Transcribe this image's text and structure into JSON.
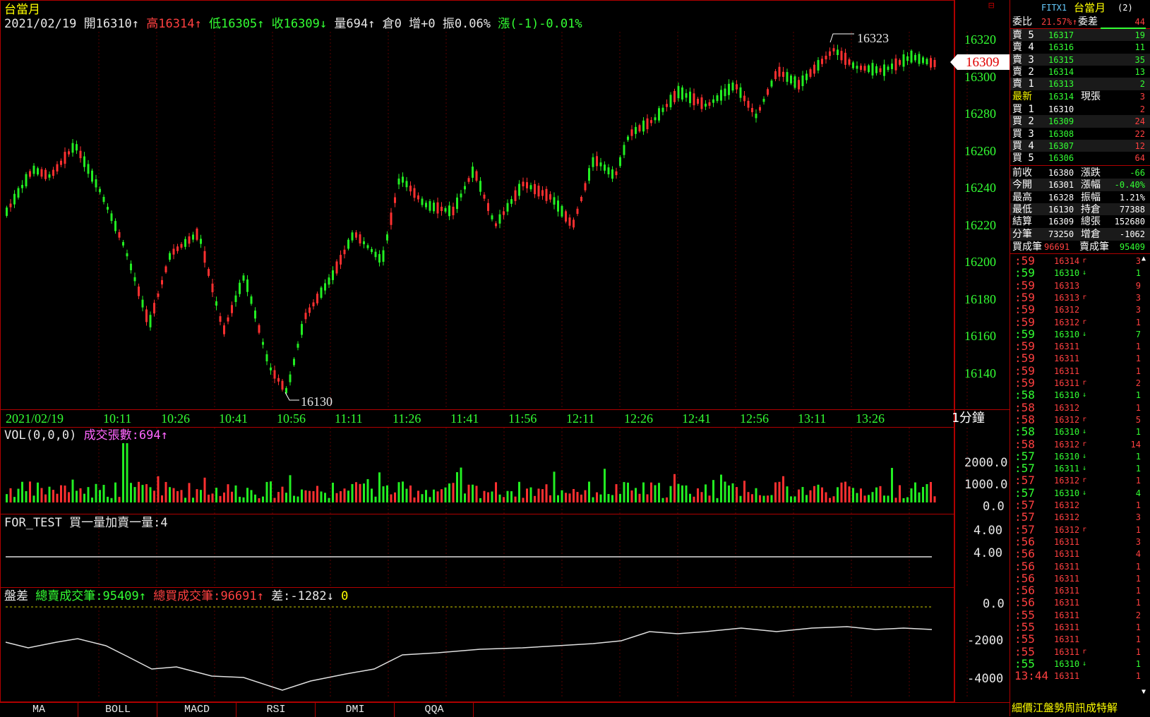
{
  "header": {
    "title": "台當月",
    "date": "2021/02/19",
    "open_label": "開",
    "open": "16310",
    "open_arrow": "↑",
    "high_label": "高",
    "high": "16314",
    "high_arrow": "↑",
    "low_label": "低",
    "low": "16305",
    "low_arrow": "↑",
    "close_label": "收",
    "close": "16309",
    "close_arrow": "↓",
    "vol_label": "量",
    "vol": "694",
    "vol_arrow": "↑",
    "oi_label": "倉",
    "oi": "0",
    "inc_label": "增",
    "inc": "+0",
    "amp_label": "振",
    "amp": "0.06%",
    "chg_label": "漲",
    "chg": "(-1)-0.01%"
  },
  "price_panel": {
    "y_ticks": [
      "16320",
      "16300",
      "16280",
      "16260",
      "16240",
      "16220",
      "16200",
      "16180",
      "16160",
      "16140"
    ],
    "current_price": "16309",
    "max_label": "16323",
    "min_label": "16130",
    "close_button": "⊟"
  },
  "time_axis": {
    "labels": [
      "2021/02/19",
      "10:11",
      "10:26",
      "10:41",
      "10:56",
      "11:11",
      "11:26",
      "11:41",
      "11:56",
      "12:11",
      "12:26",
      "12:41",
      "12:56",
      "13:11",
      "13:26"
    ],
    "period": "1分鐘"
  },
  "volume_panel": {
    "title": "VOL(0,0,0)",
    "label": "成交張數:",
    "value": "694",
    "arrow": "↑",
    "y_ticks": [
      "2000.0",
      "1000.0",
      "0.0"
    ]
  },
  "for_test_panel": {
    "title": "FOR_TEST",
    "label": "買一量加賣一量:",
    "value": "4",
    "y_ticks": [
      "4.00",
      "4.00"
    ]
  },
  "spread_panel": {
    "title": "盤差",
    "sell_label": "總賣成交筆:",
    "sell_value": "95409",
    "sell_arrow": "↑",
    "buy_label": "總買成交筆:",
    "buy_value": "96691",
    "buy_arrow": "↑",
    "diff_label": "差:",
    "diff_value": "-1282",
    "diff_arrow": "↓",
    "extra_value": "0",
    "y_ticks": [
      "0.0",
      "-2000",
      "-4000"
    ]
  },
  "quote": {
    "code": "FITX1",
    "name": "台當月",
    "badge": "(2)",
    "ratio_label": "委比",
    "ratio": "21.57%",
    "ratio_arrow": "↑",
    "diff_label": "委差",
    "diff": "44",
    "asks": [
      {
        "label": "賣 5",
        "price": "16317",
        "qty": "19"
      },
      {
        "label": "賣 4",
        "price": "16316",
        "qty": "11"
      },
      {
        "label": "賣 3",
        "price": "16315",
        "qty": "35"
      },
      {
        "label": "賣 2",
        "price": "16314",
        "qty": "13"
      },
      {
        "label": "賣 1",
        "price": "16313",
        "qty": "2"
      }
    ],
    "last": {
      "label": "最新",
      "price": "16314",
      "qty_label": "現張",
      "qty": "3"
    },
    "bids": [
      {
        "label": "買 1",
        "price": "16310",
        "qty": "2"
      },
      {
        "label": "買 2",
        "price": "16309",
        "qty": "24"
      },
      {
        "label": "買 3",
        "price": "16308",
        "qty": "22"
      },
      {
        "label": "買 4",
        "price": "16307",
        "qty": "12"
      },
      {
        "label": "買 5",
        "price": "16306",
        "qty": "64"
      }
    ],
    "stats": [
      {
        "l1": "前收",
        "v1": "16380",
        "l2": "漲跌",
        "v2": "-66"
      },
      {
        "l1": "今開",
        "v1": "16301",
        "l2": "漲幅",
        "v2": "-0.40%"
      },
      {
        "l1": "最高",
        "v1": "16328",
        "l2": "振幅",
        "v2": "1.21%"
      },
      {
        "l1": "最低",
        "v1": "16130",
        "l2": "持倉",
        "v2": "77388"
      },
      {
        "l1": "結算",
        "v1": "16309",
        "l2": "總張",
        "v2": "152680"
      },
      {
        "l1": "分筆",
        "v1": "73250",
        "l2": "增倉",
        "v2": "-1062"
      }
    ],
    "trades_row": {
      "l1": "買成筆",
      "v1": "96691",
      "l2": "賣成筆",
      "v2": "95409"
    }
  },
  "ticks": [
    {
      "t": ":59",
      "p": "16314",
      "m": "r",
      "q": "3",
      "c": "red"
    },
    {
      "t": ":59",
      "p": "16310",
      "m": "↓",
      "q": "1",
      "c": "grn"
    },
    {
      "t": ":59",
      "p": "16313",
      "m": "",
      "q": "9",
      "c": "red"
    },
    {
      "t": ":59",
      "p": "16313",
      "m": "r",
      "q": "3",
      "c": "red"
    },
    {
      "t": ":59",
      "p": "16312",
      "m": "",
      "q": "3",
      "c": "red"
    },
    {
      "t": ":59",
      "p": "16312",
      "m": "r",
      "q": "1",
      "c": "red"
    },
    {
      "t": ":59",
      "p": "16310",
      "m": "↓",
      "q": "7",
      "c": "grn"
    },
    {
      "t": ":59",
      "p": "16311",
      "m": "",
      "q": "1",
      "c": "red"
    },
    {
      "t": ":59",
      "p": "16311",
      "m": "",
      "q": "1",
      "c": "red"
    },
    {
      "t": ":59",
      "p": "16311",
      "m": "",
      "q": "1",
      "c": "red"
    },
    {
      "t": ":59",
      "p": "16311",
      "m": "r",
      "q": "2",
      "c": "red"
    },
    {
      "t": ":58",
      "p": "16310",
      "m": "↓",
      "q": "1",
      "c": "grn"
    },
    {
      "t": ":58",
      "p": "16312",
      "m": "",
      "q": "1",
      "c": "red"
    },
    {
      "t": ":58",
      "p": "16312",
      "m": "r",
      "q": "5",
      "c": "red"
    },
    {
      "t": ":58",
      "p": "16310",
      "m": "↓",
      "q": "1",
      "c": "grn"
    },
    {
      "t": ":58",
      "p": "16312",
      "m": "r",
      "q": "14",
      "c": "red"
    },
    {
      "t": ":57",
      "p": "16310",
      "m": "↓",
      "q": "1",
      "c": "grn"
    },
    {
      "t": ":57",
      "p": "16311",
      "m": "↓",
      "q": "1",
      "c": "grn"
    },
    {
      "t": ":57",
      "p": "16312",
      "m": "r",
      "q": "1",
      "c": "red"
    },
    {
      "t": ":57",
      "p": "16310",
      "m": "↓",
      "q": "4",
      "c": "grn"
    },
    {
      "t": ":57",
      "p": "16312",
      "m": "",
      "q": "1",
      "c": "red"
    },
    {
      "t": ":57",
      "p": "16312",
      "m": "",
      "q": "3",
      "c": "red"
    },
    {
      "t": ":57",
      "p": "16312",
      "m": "r",
      "q": "1",
      "c": "red"
    },
    {
      "t": ":56",
      "p": "16311",
      "m": "",
      "q": "3",
      "c": "red"
    },
    {
      "t": ":56",
      "p": "16311",
      "m": "",
      "q": "4",
      "c": "red"
    },
    {
      "t": ":56",
      "p": "16311",
      "m": "",
      "q": "1",
      "c": "red"
    },
    {
      "t": ":56",
      "p": "16311",
      "m": "",
      "q": "1",
      "c": "red"
    },
    {
      "t": ":56",
      "p": "16311",
      "m": "",
      "q": "1",
      "c": "red"
    },
    {
      "t": ":56",
      "p": "16311",
      "m": "",
      "q": "1",
      "c": "red"
    },
    {
      "t": ":55",
      "p": "16311",
      "m": "",
      "q": "2",
      "c": "red"
    },
    {
      "t": ":55",
      "p": "16311",
      "m": "",
      "q": "1",
      "c": "red"
    },
    {
      "t": ":55",
      "p": "16311",
      "m": "",
      "q": "1",
      "c": "red"
    },
    {
      "t": ":55",
      "p": "16311",
      "m": "r",
      "q": "1",
      "c": "red"
    },
    {
      "t": ":55",
      "p": "16310",
      "m": "↓",
      "q": "1",
      "c": "grn"
    },
    {
      "t": "13:44",
      "p": "16311",
      "m": "",
      "q": "1",
      "c": "red"
    }
  ],
  "tick_footer": "細價江盤勢周訊成特解",
  "tabs": [
    "MA",
    "BOLL",
    "MACD",
    "RSI",
    "DMI",
    "QQA"
  ]
}
